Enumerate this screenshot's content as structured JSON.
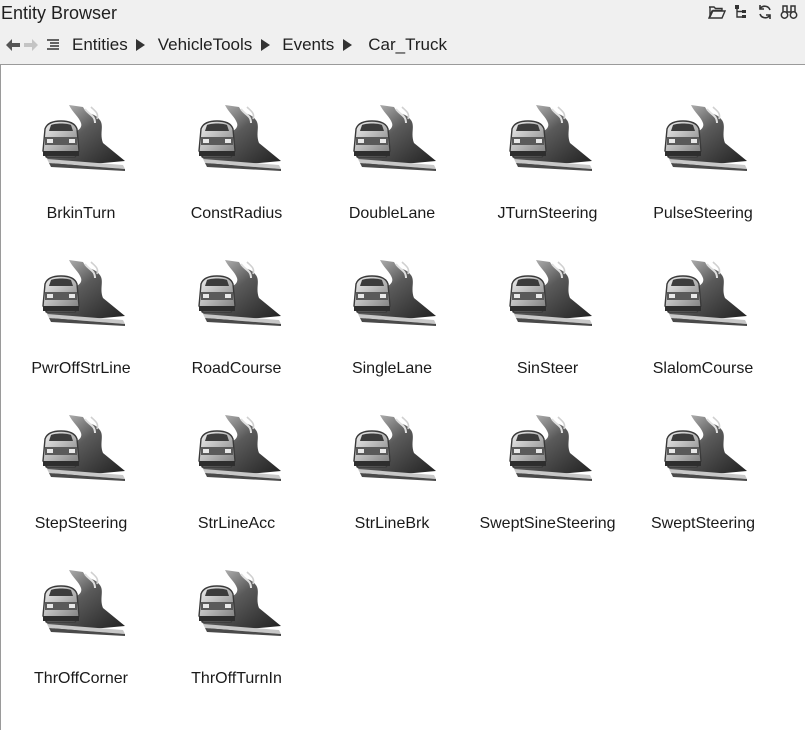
{
  "window": {
    "title": "Entity Browser",
    "tools": [
      "folder-open-icon",
      "tree-icon",
      "refresh-icon",
      "binoculars-icon"
    ]
  },
  "nav": {
    "back_icon": "back-arrow-icon",
    "forward_icon": "forward-arrow-icon",
    "list_icon": "list-icon",
    "breadcrumbs": [
      "Entities",
      "VehicleTools",
      "Events",
      "Car_Truck"
    ]
  },
  "items": [
    {
      "label": "BrkinTurn"
    },
    {
      "label": "ConstRadius"
    },
    {
      "label": "DoubleLane"
    },
    {
      "label": "JTurnSteering"
    },
    {
      "label": "PulseSteering"
    },
    {
      "label": "PwrOffStrLine"
    },
    {
      "label": "RoadCourse"
    },
    {
      "label": "SingleLane"
    },
    {
      "label": "SinSteer"
    },
    {
      "label": "SlalomCourse"
    },
    {
      "label": "StepSteering"
    },
    {
      "label": "StrLineAcc"
    },
    {
      "label": "StrLineBrk"
    },
    {
      "label": "SweptSineSteering"
    },
    {
      "label": "SweptSteering"
    },
    {
      "label": "ThrOffCorner"
    },
    {
      "label": "ThrOffTurnIn"
    }
  ],
  "item_icon": "car-road-event-icon"
}
